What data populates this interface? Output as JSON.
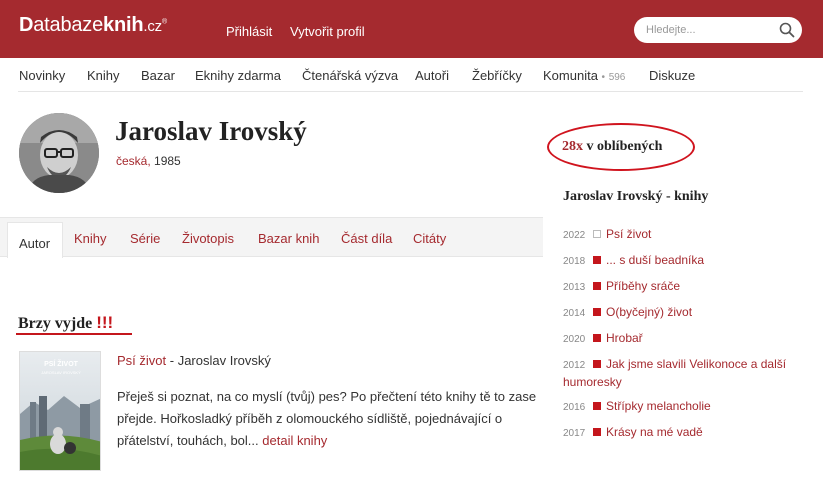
{
  "header": {
    "logo": {
      "first": "D",
      "a": "atabaze",
      "b": "knih",
      "c": ".cz",
      "reg": "®"
    },
    "login": "Přihlásit",
    "register": "Vytvořit profil",
    "search_placeholder": "Hledejte..."
  },
  "nav": {
    "items": [
      "Novinky",
      "Knihy",
      "Bazar",
      "Eknihy zdarma",
      "Čtenářská výzva",
      "Autoři",
      "Žebříčky",
      "Komunita",
      "Diskuze"
    ],
    "community_count": "596",
    "community_dot": "•"
  },
  "author": {
    "name": "Jaroslav Irovský",
    "nationality": "česká,",
    "year": "1985"
  },
  "tabs": [
    "Autor",
    "Knihy",
    "Série",
    "Životopis",
    "Bazar knih",
    "Část díla",
    "Citáty"
  ],
  "coming_soon": {
    "title": "Brzy vyjde",
    "exclaim": "!!!",
    "book_title": "Psí život",
    "separator": " - ",
    "book_author": "Jaroslav Irovský",
    "description": "Přeješ si poznat, na co myslí (tvůj) pes? Po přečtení této knihy tě to zase přejde. Hořkosladký příběh z olomouckého sídliště, pojednávající o přátelství, touhách, bol...",
    "more": "detail knihy",
    "cover_title": "PSÍ ŽIVOT",
    "cover_author": "JAROSLAV IROVSKÝ"
  },
  "sidebar": {
    "fav_count": "28x",
    "fav_text": "v oblíbených",
    "books_title": "Jaroslav Irovský - knihy",
    "books": [
      {
        "year": "2022",
        "title": "Psí život",
        "upcoming": true
      },
      {
        "year": "2018",
        "title": "... s duší beadníka",
        "upcoming": false
      },
      {
        "year": "2013",
        "title": "Příběhy sráče",
        "upcoming": false
      },
      {
        "year": "2014",
        "title": "O(byčejný) život",
        "upcoming": false
      },
      {
        "year": "2020",
        "title": "Hrobař",
        "upcoming": false
      },
      {
        "year": "2012",
        "title": "Jak jsme slavili Velikonoce a další humoresky",
        "upcoming": false
      },
      {
        "year": "2016",
        "title": "Střípky melancholie",
        "upcoming": false
      },
      {
        "year": "2017",
        "title": "Krásy na mé vadě",
        "upcoming": false
      }
    ]
  },
  "colors": {
    "brand": "#a52a2f",
    "accent_red": "#c4161c"
  }
}
